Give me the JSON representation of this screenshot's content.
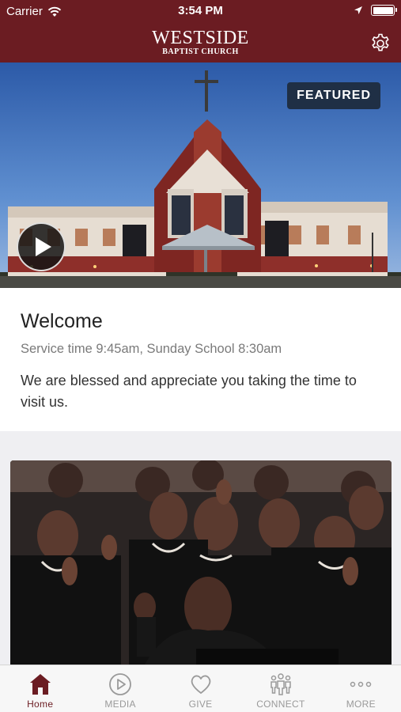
{
  "status_bar": {
    "carrier": "Carrier",
    "time": "3:54 PM"
  },
  "header": {
    "logo_line1": "WESTSIDE",
    "logo_line2": "BAPTIST CHURCH",
    "settings_icon": "gear-icon"
  },
  "hero": {
    "badge": "FEATURED",
    "play_icon": "play-icon"
  },
  "welcome": {
    "title": "Welcome",
    "service_time": "Service time 9:45am, Sunday School 8:30am",
    "message": "We are blessed and appreciate you taking the time to visit us."
  },
  "tabs": [
    {
      "label": "Home",
      "icon": "home-icon",
      "active": true
    },
    {
      "label": "MEDIA",
      "icon": "play-circle-icon",
      "active": false
    },
    {
      "label": "GIVE",
      "icon": "heart-icon",
      "active": false
    },
    {
      "label": "CONNECT",
      "icon": "people-icon",
      "active": false
    },
    {
      "label": "MORE",
      "icon": "more-dots-icon",
      "active": false
    }
  ],
  "colors": {
    "brand": "#6b1c22",
    "badge": "#1f2f45",
    "inactive_tab": "#9a9a9a"
  }
}
